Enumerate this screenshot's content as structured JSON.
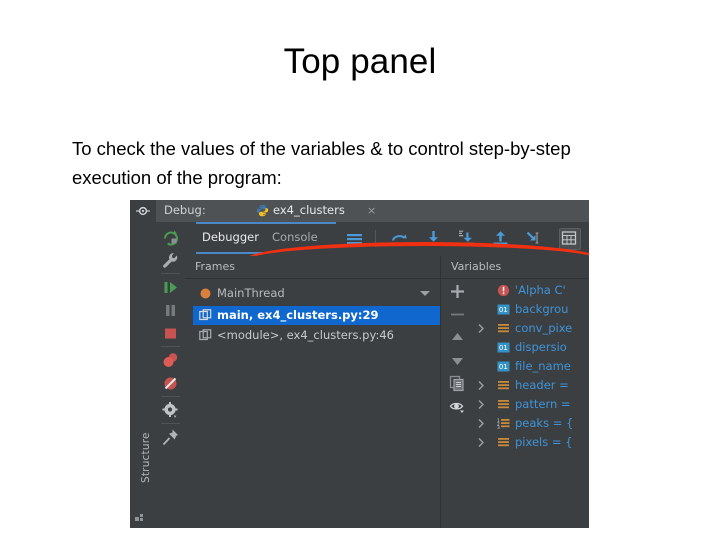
{
  "slide": {
    "title": "Top panel",
    "body": "To check the values of the variables & to control step-by-step execution of the program:"
  },
  "screenshot": {
    "titlebar": {
      "label": "Debug:",
      "tab_name": "ex4_clusters",
      "close_glyph": "×",
      "hide_icon": "hide-panel-icon",
      "python_icon": "python-logo-icon"
    },
    "structure_strip": {
      "label": "Structure",
      "icon": "structure-squares-icon"
    },
    "debug_toolbar": [
      {
        "name": "rerun-icon",
        "color": "#499c54"
      },
      {
        "name": "wrench-settings-icon",
        "color": "#a9adb0"
      },
      {
        "name": "resume-program-icon",
        "color": "#499c54"
      },
      {
        "name": "pause-program-icon",
        "color": "#77797b"
      },
      {
        "name": "stop-icon",
        "color": "#c75450"
      },
      {
        "name": "view-breakpoints-icon",
        "color": "#c75450"
      },
      {
        "name": "mute-breakpoints-icon",
        "color": "#c75450"
      },
      {
        "name": "settings-gear-icon",
        "color": "#c0c4c7"
      },
      {
        "name": "pin-icon",
        "color": "#b0b4b7"
      }
    ],
    "tabs": [
      {
        "label": "Debugger",
        "active": true
      },
      {
        "label": "Console",
        "active": false
      }
    ],
    "step_toolbar": [
      {
        "name": "show-execution-point-icon"
      },
      {
        "name": "step-over-icon"
      },
      {
        "name": "step-into-icon"
      },
      {
        "name": "force-step-into-icon"
      },
      {
        "name": "step-out-icon"
      },
      {
        "name": "run-to-cursor-icon"
      }
    ],
    "evaluate_button": {
      "name": "evaluate-expression-icon"
    },
    "panels": {
      "frames_header": "Frames",
      "variables_header": "Variables"
    },
    "frames": [
      {
        "label": "MainThread",
        "icon": "thread-dot-icon",
        "selected": false,
        "type": "thread"
      },
      {
        "label": "main, ex4_clusters.py:29",
        "icon": "frame-icon",
        "selected": true,
        "type": "frame"
      },
      {
        "label": "<module>, ex4_clusters.py:46",
        "icon": "frame-icon",
        "selected": false,
        "type": "frame"
      }
    ],
    "variables_toolbar": [
      {
        "name": "add-watch-icon",
        "glyph": "+"
      },
      {
        "name": "remove-watch-icon",
        "glyph": "–"
      },
      {
        "name": "move-up-icon",
        "glyph": "▲"
      },
      {
        "name": "move-down-icon",
        "glyph": "▼"
      },
      {
        "name": "copy-value-icon"
      },
      {
        "name": "inspect-eye-icon"
      }
    ],
    "variables": [
      {
        "label": "'Alpha C'",
        "icon": "exception-icon",
        "expandable": false
      },
      {
        "label": "backgrou",
        "icon": "number-value-icon",
        "expandable": false
      },
      {
        "label": "conv_pixe",
        "icon": "collection-icon",
        "expandable": true
      },
      {
        "label": "dispersio",
        "icon": "number-value-icon",
        "expandable": false
      },
      {
        "label": "file_name",
        "icon": "number-value-icon",
        "expandable": false
      },
      {
        "label": "header = ",
        "icon": "collection-icon",
        "expandable": true
      },
      {
        "label": "pattern =",
        "icon": "collection-icon",
        "expandable": true
      },
      {
        "label": "peaks = {",
        "icon": "indexed-collection-icon",
        "expandable": true
      },
      {
        "label": "pixels = {",
        "icon": "collection-icon",
        "expandable": true
      }
    ],
    "annotation": {
      "name": "red-ellipse-highlight",
      "color": "#f03010"
    }
  }
}
